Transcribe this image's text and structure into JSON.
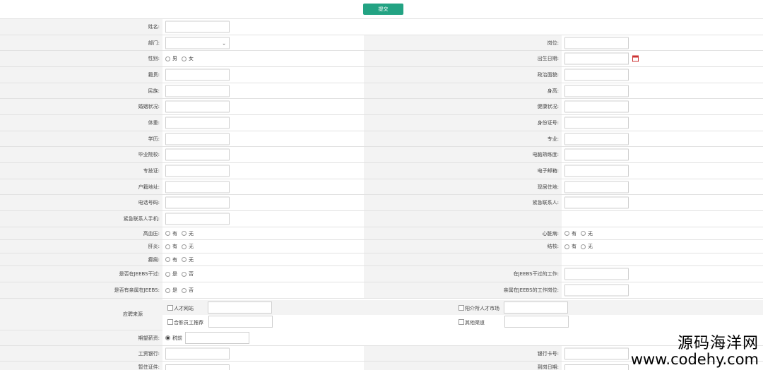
{
  "toolbar": {
    "submit_label": "提交"
  },
  "rows": [
    {
      "left": {
        "label": "姓名:",
        "type": "text"
      }
    },
    {
      "left": {
        "label": "部门:",
        "type": "select"
      },
      "right": {
        "label": "岗位:",
        "type": "text"
      }
    },
    {
      "left": {
        "label": "性别:",
        "type": "radio",
        "options": [
          "男",
          "女"
        ]
      },
      "right": {
        "label": "出生日期:",
        "type": "date"
      }
    },
    {
      "left": {
        "label": "籍贯:",
        "type": "text"
      },
      "right": {
        "label": "政治面貌:",
        "type": "text"
      }
    },
    {
      "left": {
        "label": "民族:",
        "type": "text"
      },
      "right": {
        "label": "身高:",
        "type": "text"
      }
    },
    {
      "left": {
        "label": "婚姻状况:",
        "type": "text"
      },
      "right": {
        "label": "健康状况:",
        "type": "text"
      }
    },
    {
      "left": {
        "label": "体重:",
        "type": "text"
      },
      "right": {
        "label": "身份证号:",
        "type": "text"
      }
    },
    {
      "left": {
        "label": "学历:",
        "type": "text"
      },
      "right": {
        "label": "专业:",
        "type": "text"
      }
    },
    {
      "left": {
        "label": "毕业院校:",
        "type": "text"
      },
      "right": {
        "label": "电脑熟练度:",
        "type": "text"
      }
    },
    {
      "left": {
        "label": "专技证:",
        "type": "text"
      },
      "right": {
        "label": "电子邮箱:",
        "type": "text"
      }
    },
    {
      "left": {
        "label": "户籍地址:",
        "type": "text"
      },
      "right": {
        "label": "现居住地:",
        "type": "text"
      }
    },
    {
      "left": {
        "label": "电话号码:",
        "type": "text"
      },
      "right": {
        "label": "紧急联系人:",
        "type": "text"
      }
    },
    {
      "left": {
        "label": "紧急联系人手机:",
        "type": "text"
      }
    },
    {
      "left": {
        "label": "高血压:",
        "type": "radio",
        "options": [
          "有",
          "无"
        ]
      },
      "right": {
        "label": "心脏病:",
        "type": "radio",
        "options": [
          "有",
          "无"
        ]
      }
    },
    {
      "left": {
        "label": "肝炎:",
        "type": "radio",
        "options": [
          "有",
          "无"
        ]
      },
      "right": {
        "label": "结核:",
        "type": "radio",
        "options": [
          "有",
          "无"
        ]
      }
    },
    {
      "left": {
        "label": "癫痫:",
        "type": "radio",
        "options": [
          "有",
          "无"
        ]
      }
    },
    {
      "left": {
        "label": "是否在JEEBS干过:",
        "type": "radio",
        "options": [
          "是",
          "否"
        ]
      },
      "right": {
        "label": "在JEEBS干过的工作:",
        "type": "text"
      }
    },
    {
      "left": {
        "label": "是否有亲属在JEEBS:",
        "type": "radio",
        "options": [
          "是",
          "否"
        ]
      },
      "right": {
        "label": "亲属在JEEBS的工作岗位:",
        "type": "text"
      }
    }
  ],
  "source": {
    "label": "应聘来源",
    "options": [
      "人才网站",
      "阳介所人才市场",
      "合影员工推荐",
      "其他渠道"
    ]
  },
  "probation": {
    "label": "期望薪资:",
    "option": "税前"
  },
  "bank": {
    "left_label": "工资银行:",
    "right_label": "银行卡号:"
  },
  "partial_row": {
    "left_label": "暂住证件:",
    "right_label": "到岗日期:"
  },
  "watermark": {
    "line1": "源码海洋网",
    "line2": "www.codehy.com"
  }
}
